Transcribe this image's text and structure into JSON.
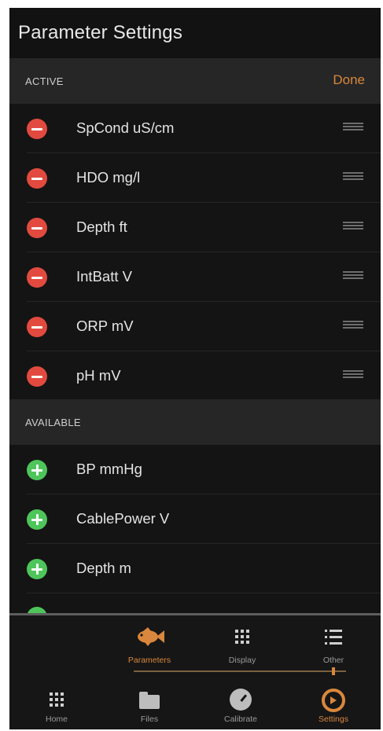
{
  "header": {
    "title": "Parameter Settings"
  },
  "active_section": {
    "label": "ACTIVE",
    "done_label": "Done",
    "items": [
      {
        "label": "SpCond uS/cm"
      },
      {
        "label": "HDO mg/l"
      },
      {
        "label": "Depth ft"
      },
      {
        "label": "IntBatt V"
      },
      {
        "label": "ORP mV"
      },
      {
        "label": "pH mV"
      }
    ]
  },
  "available_section": {
    "label": "AVAILABLE",
    "items": [
      {
        "label": "BP mmHg"
      },
      {
        "label": "CablePower V"
      },
      {
        "label": "Depth m"
      }
    ]
  },
  "sub_tabs": [
    {
      "label": "Parameters",
      "icon": "fish-icon",
      "active": true
    },
    {
      "label": "Display",
      "icon": "grid-icon",
      "active": false
    },
    {
      "label": "Other",
      "icon": "list-icon",
      "active": false
    }
  ],
  "main_tabs": [
    {
      "label": "Home",
      "icon": "grid-icon",
      "active": false
    },
    {
      "label": "Files",
      "icon": "folder-icon",
      "active": false
    },
    {
      "label": "Calibrate",
      "icon": "gauge-icon",
      "active": false
    },
    {
      "label": "Settings",
      "icon": "settings-icon",
      "active": true
    }
  ],
  "colors": {
    "accent": "#d9873d",
    "remove": "#e24a3f",
    "add": "#4ec55a",
    "background": "#141414",
    "section_header": "#262626"
  }
}
